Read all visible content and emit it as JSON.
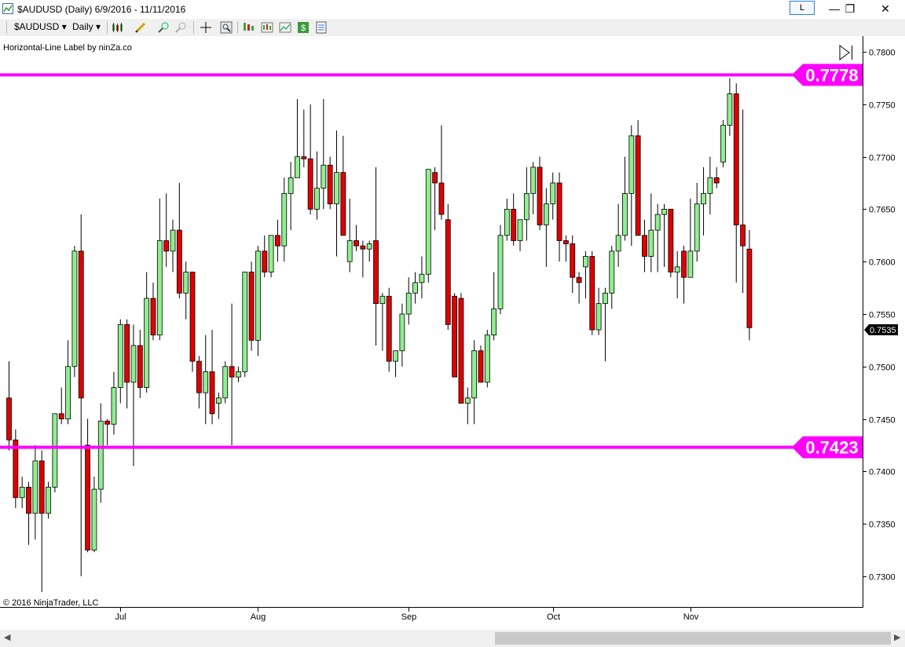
{
  "window": {
    "title": "$AUDUSD (Daily)  6/9/2016 - 11/11/2016",
    "icons": [
      "chart-window-icon",
      "minimize-icon",
      "restore-icon",
      "close-icon"
    ],
    "link_button": "L",
    "minimize": "—",
    "restore": "❐",
    "close": "✕"
  },
  "toolbar": {
    "instrument": "$AUDUSD",
    "interval": "Daily",
    "icons": [
      "bar-style-icon",
      "pencil-icon",
      "zoom-in-icon",
      "zoom-out-icon",
      "crosshair-icon",
      "search-icon",
      "indicators-icon",
      "strategies-icon",
      "chart-trader-icon",
      "dollar-icon",
      "properties-icon"
    ]
  },
  "indicator_label": "Horizontal-Line Label by ninZa.co",
  "copyright": "© 2016 NinjaTrader, LLC",
  "colors": {
    "up": "#90ee90",
    "down": "#e00000",
    "line": "#ff00ff",
    "label_bg": "#ff00ff"
  },
  "chart_data": {
    "type": "candlestick",
    "ylim": [
      0.727,
      0.7815
    ],
    "y_ticks": [
      "0.7800",
      "0.7750",
      "0.7700",
      "0.7650",
      "0.7600",
      "0.7550",
      "0.7500",
      "0.7450",
      "0.7400",
      "0.7350",
      "0.7300"
    ],
    "x_labels": [
      {
        "label": "Jul",
        "index": 17
      },
      {
        "label": "Aug",
        "index": 38
      },
      {
        "label": "Sep",
        "index": 61
      },
      {
        "label": "Oct",
        "index": 83
      },
      {
        "label": "Nov",
        "index": 104
      }
    ],
    "last_price": "0.7535",
    "horizontal_lines": [
      {
        "price": 0.7778,
        "label": "0.7778"
      },
      {
        "price": 0.7423,
        "label": "0.7423"
      }
    ],
    "candles": [
      [
        0.747,
        0.7505,
        0.742,
        0.743
      ],
      [
        0.743,
        0.744,
        0.7365,
        0.7375
      ],
      [
        0.7375,
        0.7395,
        0.7365,
        0.7385
      ],
      [
        0.7385,
        0.739,
        0.733,
        0.736
      ],
      [
        0.736,
        0.7425,
        0.7335,
        0.741
      ],
      [
        0.741,
        0.742,
        0.7285,
        0.736
      ],
      [
        0.736,
        0.739,
        0.7355,
        0.7385
      ],
      [
        0.7385,
        0.7455,
        0.738,
        0.7455
      ],
      [
        0.7455,
        0.748,
        0.7445,
        0.745
      ],
      [
        0.745,
        0.7525,
        0.7445,
        0.75
      ],
      [
        0.75,
        0.7615,
        0.749,
        0.761
      ],
      [
        0.761,
        0.7645,
        0.73,
        0.747
      ],
      [
        0.7425,
        0.745,
        0.7323,
        0.7325
      ],
      [
        0.7325,
        0.7395,
        0.7323,
        0.7383
      ],
      [
        0.7383,
        0.7465,
        0.737,
        0.7448
      ],
      [
        0.7448,
        0.745,
        0.7425,
        0.7445
      ],
      [
        0.7445,
        0.7495,
        0.7435,
        0.748
      ],
      [
        0.748,
        0.7545,
        0.7465,
        0.754
      ],
      [
        0.754,
        0.7545,
        0.746,
        0.7485
      ],
      [
        0.7485,
        0.754,
        0.7405,
        0.752
      ],
      [
        0.752,
        0.7535,
        0.747,
        0.748
      ],
      [
        0.748,
        0.759,
        0.7475,
        0.7565
      ],
      [
        0.7565,
        0.758,
        0.7525,
        0.753
      ],
      [
        0.753,
        0.766,
        0.7525,
        0.762
      ],
      [
        0.762,
        0.7665,
        0.7595,
        0.761
      ],
      [
        0.761,
        0.764,
        0.759,
        0.763
      ],
      [
        0.763,
        0.7675,
        0.7565,
        0.757
      ],
      [
        0.757,
        0.76,
        0.7545,
        0.759
      ],
      [
        0.759,
        0.759,
        0.7495,
        0.7505
      ],
      [
        0.7505,
        0.751,
        0.746,
        0.7475
      ],
      [
        0.7475,
        0.753,
        0.7445,
        0.7495
      ],
      [
        0.7495,
        0.7535,
        0.7445,
        0.7455
      ],
      [
        0.7465,
        0.7475,
        0.745,
        0.747
      ],
      [
        0.747,
        0.7505,
        0.7465,
        0.75
      ],
      [
        0.75,
        0.756,
        0.7425,
        0.749
      ],
      [
        0.749,
        0.75,
        0.7485,
        0.7495
      ],
      [
        0.7495,
        0.759,
        0.749,
        0.759
      ],
      [
        0.759,
        0.76,
        0.7515,
        0.7525
      ],
      [
        0.7525,
        0.7615,
        0.751,
        0.761
      ],
      [
        0.761,
        0.7625,
        0.7585,
        0.759
      ],
      [
        0.759,
        0.7625,
        0.7585,
        0.7625
      ],
      [
        0.7625,
        0.764,
        0.76,
        0.7615
      ],
      [
        0.7615,
        0.768,
        0.76,
        0.7665
      ],
      [
        0.7665,
        0.7695,
        0.763,
        0.768
      ],
      [
        0.768,
        0.7755,
        0.768,
        0.77
      ],
      [
        0.77,
        0.7745,
        0.769,
        0.7698
      ],
      [
        0.7698,
        0.775,
        0.7645,
        0.765
      ],
      [
        0.765,
        0.7705,
        0.764,
        0.767
      ],
      [
        0.767,
        0.7755,
        0.765,
        0.7692
      ],
      [
        0.7692,
        0.77,
        0.765,
        0.7655
      ],
      [
        0.7655,
        0.7725,
        0.7605,
        0.7685
      ],
      [
        0.7685,
        0.772,
        0.7625,
        0.7625
      ],
      [
        0.76,
        0.766,
        0.759,
        0.762
      ],
      [
        0.762,
        0.7635,
        0.761,
        0.7615
      ],
      [
        0.7615,
        0.762,
        0.7585,
        0.7612
      ],
      [
        0.7612,
        0.762,
        0.76,
        0.7617
      ],
      [
        0.762,
        0.769,
        0.752,
        0.756
      ],
      [
        0.756,
        0.757,
        0.7515,
        0.7567
      ],
      [
        0.7567,
        0.7575,
        0.7495,
        0.7505
      ],
      [
        0.7505,
        0.751,
        0.749,
        0.7515
      ],
      [
        0.7515,
        0.756,
        0.75,
        0.755
      ],
      [
        0.755,
        0.7585,
        0.754,
        0.757
      ],
      [
        0.757,
        0.759,
        0.756,
        0.758
      ],
      [
        0.758,
        0.7605,
        0.7565,
        0.7588
      ],
      [
        0.7588,
        0.7685,
        0.758,
        0.7688
      ],
      [
        0.7685,
        0.769,
        0.763,
        0.7675
      ],
      [
        0.7675,
        0.773,
        0.764,
        0.7645
      ],
      [
        0.764,
        0.7655,
        0.7535,
        0.754
      ],
      [
        0.7567,
        0.757,
        0.749,
        0.749
      ],
      [
        0.7565,
        0.757,
        0.7465,
        0.7465
      ],
      [
        0.7465,
        0.748,
        0.7445,
        0.747
      ],
      [
        0.747,
        0.7525,
        0.7445,
        0.7515
      ],
      [
        0.7515,
        0.752,
        0.7485,
        0.7485
      ],
      [
        0.7485,
        0.7535,
        0.748,
        0.753
      ],
      [
        0.753,
        0.759,
        0.7525,
        0.7555
      ],
      [
        0.7555,
        0.7635,
        0.755,
        0.7625
      ],
      [
        0.7625,
        0.766,
        0.762,
        0.765
      ],
      [
        0.765,
        0.7665,
        0.7615,
        0.762
      ],
      [
        0.762,
        0.764,
        0.761,
        0.764
      ],
      [
        0.764,
        0.769,
        0.762,
        0.7665
      ],
      [
        0.7665,
        0.7695,
        0.7645,
        0.769
      ],
      [
        0.769,
        0.77,
        0.763,
        0.7635
      ],
      [
        0.7635,
        0.767,
        0.7595,
        0.7655
      ],
      [
        0.7655,
        0.7685,
        0.764,
        0.7675
      ],
      [
        0.7675,
        0.7685,
        0.76,
        0.762
      ],
      [
        0.762,
        0.7625,
        0.76,
        0.7617
      ],
      [
        0.7617,
        0.7625,
        0.757,
        0.7585
      ],
      [
        0.7585,
        0.759,
        0.756,
        0.758
      ],
      [
        0.7595,
        0.761,
        0.7565,
        0.7605
      ],
      [
        0.7605,
        0.761,
        0.753,
        0.7535
      ],
      [
        0.7535,
        0.7575,
        0.753,
        0.756
      ],
      [
        0.756,
        0.7575,
        0.7505,
        0.757
      ],
      [
        0.757,
        0.7615,
        0.7555,
        0.761
      ],
      [
        0.761,
        0.7655,
        0.7595,
        0.7625
      ],
      [
        0.7625,
        0.77,
        0.762,
        0.7665
      ],
      [
        0.7665,
        0.773,
        0.7615,
        0.772
      ],
      [
        0.772,
        0.7735,
        0.7625,
        0.7625
      ],
      [
        0.7625,
        0.764,
        0.759,
        0.7605
      ],
      [
        0.7605,
        0.7665,
        0.759,
        0.763
      ],
      [
        0.763,
        0.7655,
        0.759,
        0.7645
      ],
      [
        0.7645,
        0.7655,
        0.7595,
        0.765
      ],
      [
        0.765,
        0.765,
        0.7585,
        0.759
      ],
      [
        0.759,
        0.761,
        0.7565,
        0.7595
      ],
      [
        0.761,
        0.7615,
        0.756,
        0.7585
      ],
      [
        0.7585,
        0.766,
        0.7585,
        0.761
      ],
      [
        0.761,
        0.7675,
        0.76,
        0.7655
      ],
      [
        0.7655,
        0.769,
        0.7625,
        0.7665
      ],
      [
        0.7665,
        0.77,
        0.7645,
        0.768
      ],
      [
        0.768,
        0.769,
        0.767,
        0.7675
      ],
      [
        0.7695,
        0.7735,
        0.769,
        0.773
      ],
      [
        0.773,
        0.7775,
        0.772,
        0.776
      ],
      [
        0.776,
        0.777,
        0.758,
        0.7635
      ],
      [
        0.7635,
        0.7745,
        0.757,
        0.7615
      ],
      [
        0.7612,
        0.763,
        0.7525,
        0.7537
      ]
    ]
  }
}
